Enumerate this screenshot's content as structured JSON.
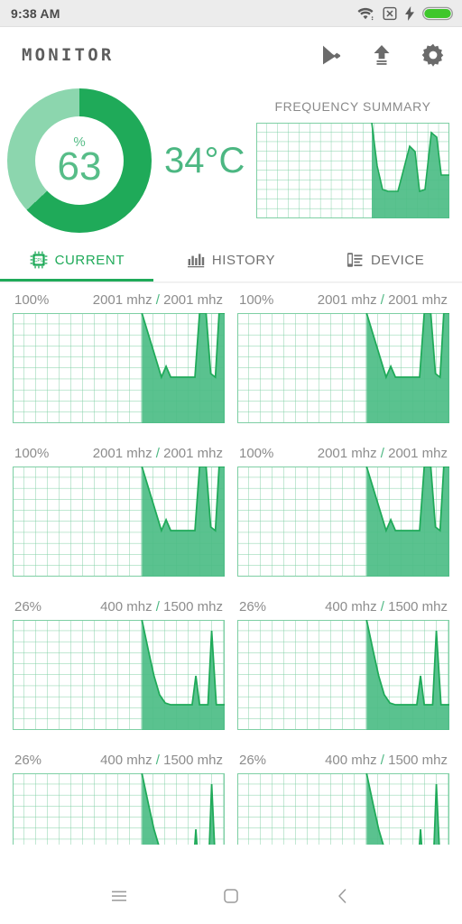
{
  "statusbar": {
    "time": "9:38 AM",
    "icons": [
      "wifi-icon",
      "no-sim-icon",
      "charging-bolt-icon",
      "battery-icon"
    ],
    "battery_color": "#3ec72b"
  },
  "appbar": {
    "title": "MONITOR",
    "actions": [
      "play-store-icon",
      "upload-icon",
      "settings-gear-icon"
    ],
    "icon_color": "#6b6b6b"
  },
  "summary": {
    "gauge": {
      "value": "63",
      "unit": "%",
      "percent": 63,
      "arc_color": "#1faa59",
      "track_color": "#8cd6ae",
      "text_color": "#57bd88"
    },
    "temperature": "34°C",
    "frequency_summary": {
      "title": "FREQUENCY SUMMARY"
    }
  },
  "tabs": [
    {
      "label": "CURRENT",
      "icon": "cpu-chip-icon",
      "active": true
    },
    {
      "label": "HISTORY",
      "icon": "bar-chart-icon",
      "active": false
    },
    {
      "label": "DEVICE",
      "icon": "device-list-icon",
      "active": false
    }
  ],
  "accent_color": "#1faa59",
  "cores": [
    {
      "percent": "100%",
      "current_freq": "2001 mhz",
      "separator": "/",
      "max_freq": "2001 mhz"
    },
    {
      "percent": "100%",
      "current_freq": "2001 mhz",
      "separator": "/",
      "max_freq": "2001 mhz"
    },
    {
      "percent": "100%",
      "current_freq": "2001 mhz",
      "separator": "/",
      "max_freq": "2001 mhz"
    },
    {
      "percent": "100%",
      "current_freq": "2001 mhz",
      "separator": "/",
      "max_freq": "2001 mhz"
    },
    {
      "percent": "26%",
      "current_freq": "400 mhz",
      "separator": "/",
      "max_freq": "1500 mhz"
    },
    {
      "percent": "26%",
      "current_freq": "400 mhz",
      "separator": "/",
      "max_freq": "1500 mhz"
    },
    {
      "percent": "26%",
      "current_freq": "400 mhz",
      "separator": "/",
      "max_freq": "1500 mhz"
    },
    {
      "percent": "26%",
      "current_freq": "400 mhz",
      "separator": "/",
      "max_freq": "1500 mhz"
    }
  ],
  "navbar": {
    "buttons": [
      "recents-menu-icon",
      "home-square-icon",
      "back-chevron-icon"
    ],
    "icon_color": "#9a9a9a"
  },
  "chart_data": [
    {
      "type": "area",
      "title": "FREQUENCY SUMMARY",
      "grid": true,
      "xlim": [
        0,
        100
      ],
      "ylim": [
        0,
        100
      ],
      "x": [
        0,
        60,
        61,
        63,
        66,
        68,
        72,
        78,
        80,
        83,
        85,
        87,
        91,
        93,
        95,
        100
      ],
      "y": [
        0,
        0,
        100,
        55,
        30,
        28,
        28,
        28,
        75,
        70,
        30,
        28,
        95,
        92,
        55,
        55
      ],
      "line_color": "#1faa59",
      "fill_color": "#4cbd85"
    },
    {
      "type": "area",
      "title": "core-0",
      "grid": true,
      "xlim": [
        0,
        100
      ],
      "ylim": [
        0,
        100
      ],
      "x": [
        0,
        61,
        62,
        70,
        72,
        74,
        76,
        86,
        88,
        91,
        93,
        95,
        97,
        100
      ],
      "y": [
        0,
        0,
        100,
        42,
        52,
        42,
        42,
        42,
        100,
        100,
        45,
        42,
        100,
        100
      ],
      "line_color": "#1faa59",
      "fill_color": "#4cbd85"
    },
    {
      "type": "area",
      "title": "core-4",
      "grid": true,
      "xlim": [
        0,
        100
      ],
      "ylim": [
        0,
        100
      ],
      "x": [
        0,
        61,
        62,
        66,
        70,
        73,
        76,
        84,
        86,
        88,
        90,
        93,
        95,
        97,
        100
      ],
      "y": [
        0,
        0,
        100,
        60,
        32,
        22,
        22,
        22,
        60,
        22,
        22,
        22,
        88,
        22,
        22
      ],
      "line_color": "#1faa59",
      "fill_color": "#4cbd85"
    },
    {
      "type": "area",
      "title": "core-6-clipped",
      "grid": true,
      "xlim": [
        0,
        100
      ],
      "ylim": [
        0,
        100
      ],
      "x": [
        0,
        61,
        62,
        72,
        86,
        88,
        90,
        93,
        95,
        97,
        100
      ],
      "y": [
        0,
        0,
        100,
        0,
        0,
        45,
        0,
        0,
        78,
        0,
        0
      ],
      "line_color": "#1faa59",
      "fill_color": "#4cbd85"
    }
  ]
}
